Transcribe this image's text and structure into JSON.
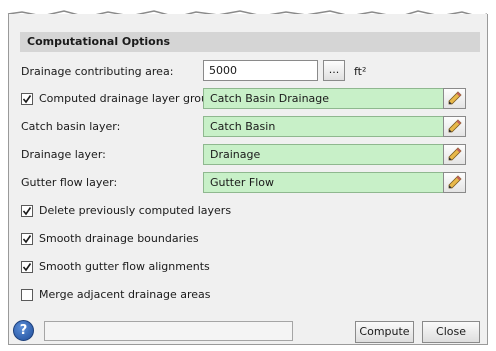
{
  "section": {
    "title": "Computational Options"
  },
  "drainage_area": {
    "label": "Drainage contributing area:",
    "value": "5000",
    "browse_label": "...",
    "unit": "ft²"
  },
  "computed_group": {
    "label": "Computed drainage layer group:",
    "checked": true,
    "value": "Catch Basin Drainage"
  },
  "catch_basin_layer": {
    "label": "Catch basin layer:",
    "value": "Catch Basin"
  },
  "drainage_layer": {
    "label": "Drainage layer:",
    "value": "Drainage"
  },
  "gutter_flow_layer": {
    "label": "Gutter flow layer:",
    "value": "Gutter Flow"
  },
  "options": [
    {
      "label": "Delete previously computed layers",
      "checked": true
    },
    {
      "label": "Smooth drainage boundaries",
      "checked": true
    },
    {
      "label": "Smooth gutter flow alignments",
      "checked": true
    },
    {
      "label": "Merge adjacent drainage areas",
      "checked": false
    }
  ],
  "footer": {
    "help_label": "?",
    "status_text": "",
    "compute_label": "Compute",
    "close_label": "Close"
  },
  "colors": {
    "field_green": "#c8f0c8",
    "header_gray": "#d5d5d5",
    "dialog_bg": "#f0f0f0",
    "help_blue": "#2a5db0"
  }
}
